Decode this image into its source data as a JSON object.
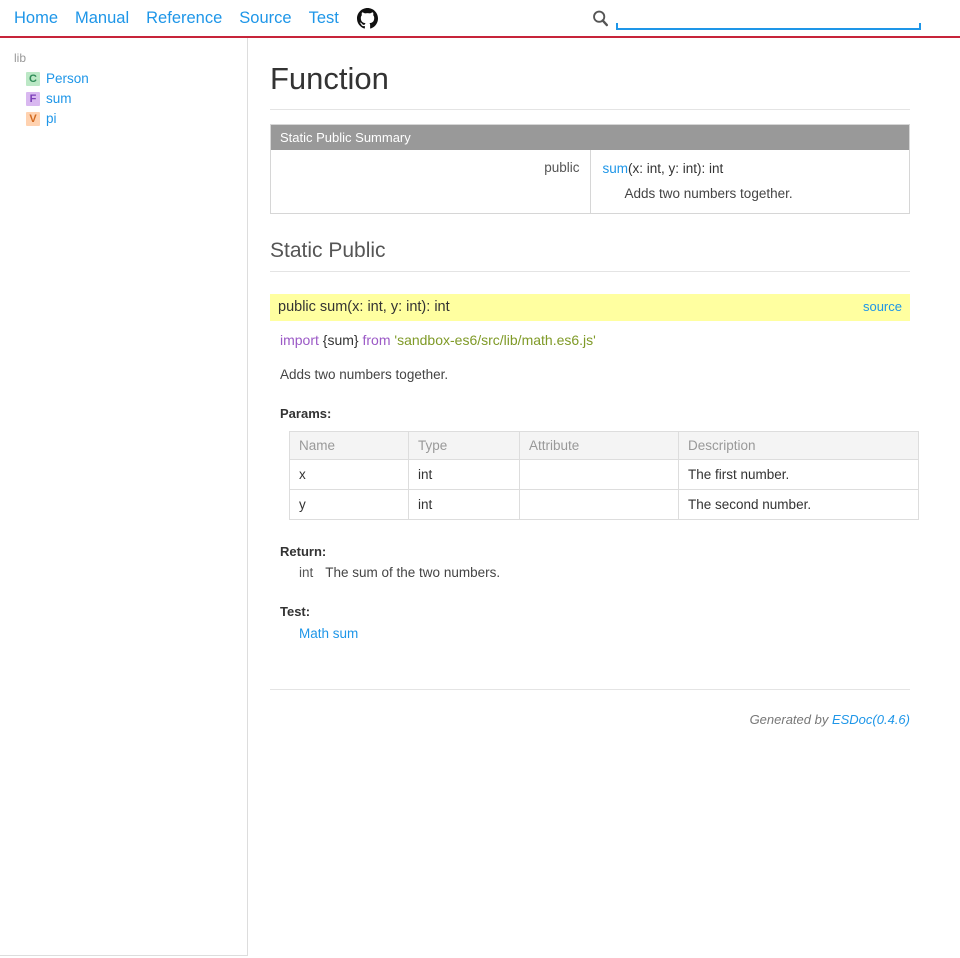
{
  "header": {
    "nav": [
      {
        "label": "Home"
      },
      {
        "label": "Manual"
      },
      {
        "label": "Reference"
      },
      {
        "label": "Source"
      },
      {
        "label": "Test"
      }
    ],
    "github_icon": "github-icon",
    "search": {
      "icon": "search-icon",
      "value": "",
      "placeholder": ""
    }
  },
  "sidebar": {
    "dir_label": "lib",
    "items": [
      {
        "kind": "C",
        "kind_name": "class",
        "label": "Person"
      },
      {
        "kind": "F",
        "kind_name": "function",
        "label": "sum"
      },
      {
        "kind": "V",
        "kind_name": "variable",
        "label": "pi"
      }
    ]
  },
  "main": {
    "page_title": "Function",
    "summary": {
      "caption": "Static Public Summary",
      "rows": [
        {
          "access": "public",
          "name": "sum",
          "signature_rest": "(x: int, y: int): int",
          "description": "Adds two numbers together."
        }
      ]
    },
    "section_title": "Static Public",
    "detail": {
      "signature": "public sum(x: int, y: int): int",
      "source_label": "source",
      "import": {
        "keyword_import": "import",
        "binding": "{sum}",
        "keyword_from": "from",
        "path": "'sandbox-es6/src/lib/math.es6.js'"
      },
      "description": "Adds two numbers together.",
      "params_label": "Params:",
      "params_headers": [
        "Name",
        "Type",
        "Attribute",
        "Description"
      ],
      "params_rows": [
        {
          "name": "x",
          "type": "int",
          "attribute": "",
          "description": "The first number."
        },
        {
          "name": "y",
          "type": "int",
          "attribute": "",
          "description": "The second number."
        }
      ],
      "return_label": "Return:",
      "return_type": "int",
      "return_description": "The sum of the two numbers.",
      "test_label": "Test:",
      "tests": [
        {
          "label": "Math sum"
        }
      ]
    }
  },
  "footer": {
    "generated_by": "Generated by ",
    "esdoc_link": "ESDoc(0.4.6)"
  },
  "colors": {
    "accent_link": "#1e96e8",
    "header_rule": "#c7243a",
    "summary_header_bg": "#999999",
    "highlight_bg": "#ffffa0",
    "string_green": "#7f9a27",
    "keyword_purple": "#9b59c6"
  }
}
